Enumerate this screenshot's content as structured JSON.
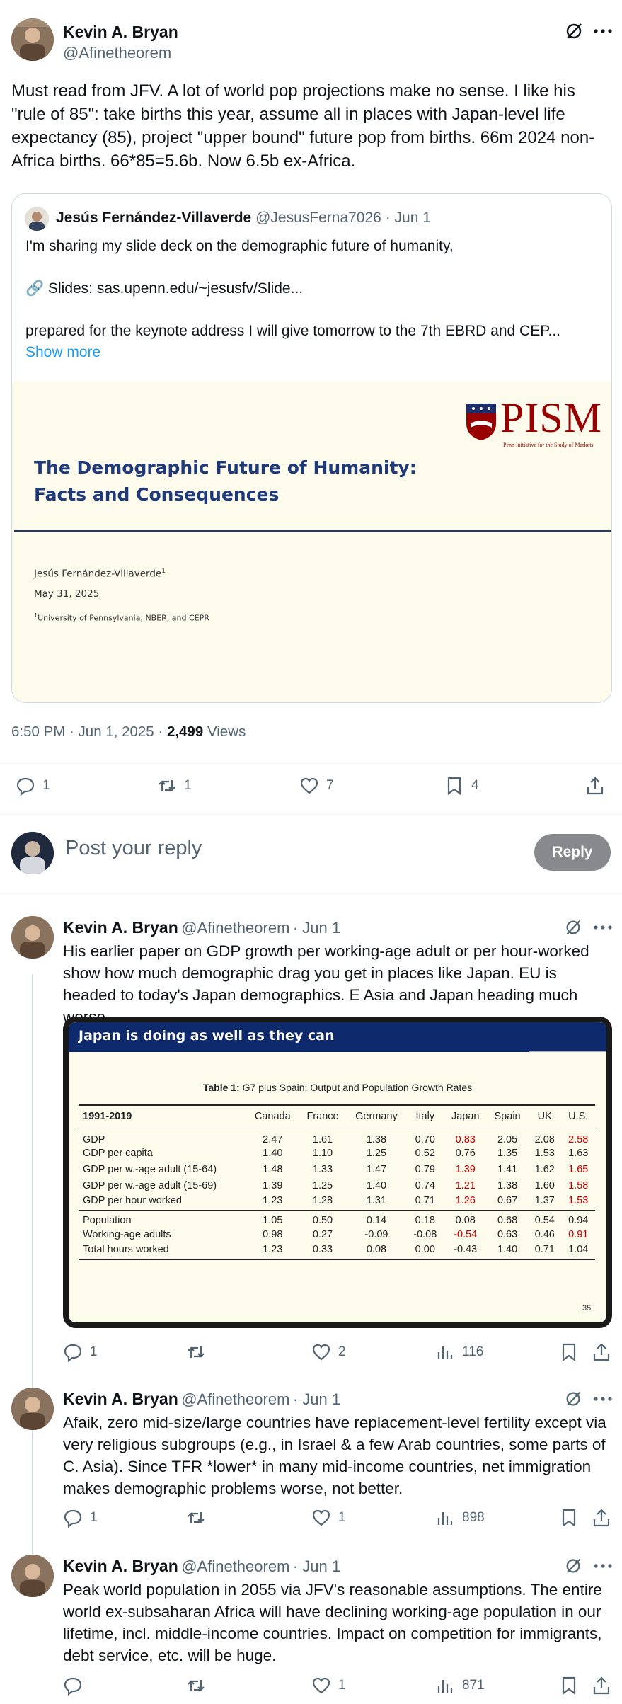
{
  "main_tweet": {
    "author_name": "Kevin A. Bryan",
    "author_handle": "@Afinetheorem",
    "text": "Must read from JFV. A lot of world pop projections make no sense. I like his \"rule of 85\": take births this year, assume all in places with Japan-level life expectancy (85), project \"upper bound\" future pop from births. 66m 2024 non-Africa births. 66*85=5.6b. Now 6.5b ex-Africa.",
    "quote": {
      "author_name": "Jesús Fernández-Villaverde",
      "author_handle": "@JesusFerna7026",
      "date": "· Jun 1",
      "line1": "I'm sharing my slide deck on the demographic future of humanity,",
      "line2": "🔗 Slides: sas.upenn.edu/~jesusfv/Slide...",
      "line3": "prepared for the keynote address I will give tomorrow to the 7th EBRD and CEP...",
      "show_more": "Show more",
      "slide": {
        "logo_text": "PISM",
        "logo_sub": "Penn Initiative for the Study of Markets",
        "title_line1": "The Demographic Future of Humanity:",
        "title_line2": "Facts and Consequences",
        "author": "Jesús Fernández-Villaverde",
        "author_sup": "1",
        "date": "May 31, 2025",
        "affil_sup": "1",
        "affil": "University of Pennsylvania, NBER, and CEPR"
      }
    },
    "timestamp": "6:50 PM · Jun 1, 2025 · ",
    "views_count": "2,499",
    "views_label": " Views",
    "replies": "1",
    "retweets": "1",
    "likes": "7",
    "bookmarks": "4"
  },
  "reply_box": {
    "placeholder": "Post your reply",
    "button": "Reply"
  },
  "replies": [
    {
      "author_name": "Kevin A. Bryan",
      "author_handle": "@Afinetheorem",
      "date": "· Jun 1",
      "text": "His earlier paper on GDP growth per working-age adult or per hour-worked show how much demographic drag you get in places like Japan. EU is headed to today's Japan demographics. E Asia and Japan heading much worse.",
      "replies": "1",
      "retweets": "",
      "likes": "2",
      "views": "116"
    },
    {
      "author_name": "Kevin A. Bryan",
      "author_handle": "@Afinetheorem",
      "date": "· Jun 1",
      "text": "Afaik, zero mid-size/large countries have replacement-level fertility except via very religious subgroups (e.g., in Israel & a few Arab countries, some parts of C. Asia). Since TFR *lower* in many mid-income countries, net immigration makes demographic problems worse, not better.",
      "replies": "1",
      "retweets": "",
      "likes": "1",
      "views": "898"
    },
    {
      "author_name": "Kevin A. Bryan",
      "author_handle": "@Afinetheorem",
      "date": "· Jun 1",
      "text": "Peak world population in 2055 via JFV's reasonable assumptions. The entire world ex-subsaharan Africa will have declining working-age population in our lifetime, incl. middle-income countries. Impact on competition for immigrants, debt service, etc. will be huge.",
      "replies": "",
      "retweets": "",
      "likes": "1",
      "views": "871"
    }
  ],
  "table_slide": {
    "banner": "Japan is doing as well as they can",
    "caption_bold": "Table 1:",
    "caption": " G7 plus Spain: Output and Population Growth Rates",
    "header": [
      "1991-2019",
      "Canada",
      "France",
      "Germany",
      "Italy",
      "Japan",
      "Spain",
      "UK",
      "U.S."
    ],
    "rows_a": [
      [
        "GDP",
        "2.47",
        "1.61",
        "1.38",
        "0.70",
        "0.83",
        "2.05",
        "2.08",
        "2.58"
      ],
      [
        "GDP per capita",
        "1.40",
        "1.10",
        "1.25",
        "0.52",
        "0.76",
        "1.35",
        "1.53",
        "1.63"
      ],
      [
        "GDP per w.-age adult (15-64)",
        "1.48",
        "1.33",
        "1.47",
        "0.79",
        "1.39",
        "1.41",
        "1.62",
        "1.65"
      ],
      [
        "GDP per w.-age adult (15-69)",
        "1.39",
        "1.25",
        "1.40",
        "0.74",
        "1.21",
        "1.38",
        "1.60",
        "1.58"
      ],
      [
        "GDP per hour worked",
        "1.23",
        "1.28",
        "1.31",
        "0.71",
        "1.26",
        "0.67",
        "1.37",
        "1.53"
      ]
    ],
    "rows_b": [
      [
        "Population",
        "1.05",
        "0.50",
        "0.14",
        "0.18",
        "0.08",
        "0.68",
        "0.54",
        "0.94"
      ],
      [
        "Working-age adults",
        "0.98",
        "0.27",
        "-0.09",
        "-0.08",
        "-0.54",
        "0.63",
        "0.46",
        "0.91"
      ],
      [
        "Total hours worked",
        "1.23",
        "0.33",
        "0.08",
        "0.00",
        "-0.43",
        "1.40",
        "0.71",
        "1.04"
      ]
    ],
    "page_number": "35",
    "highlight_color": "#c00000"
  },
  "colors": {
    "link": "#1d9bf0",
    "slide_bg": "#fdfbec",
    "slide_title": "#1f3a7a",
    "banner_bg": "#0e2a6c",
    "penn_red": "#990000"
  }
}
